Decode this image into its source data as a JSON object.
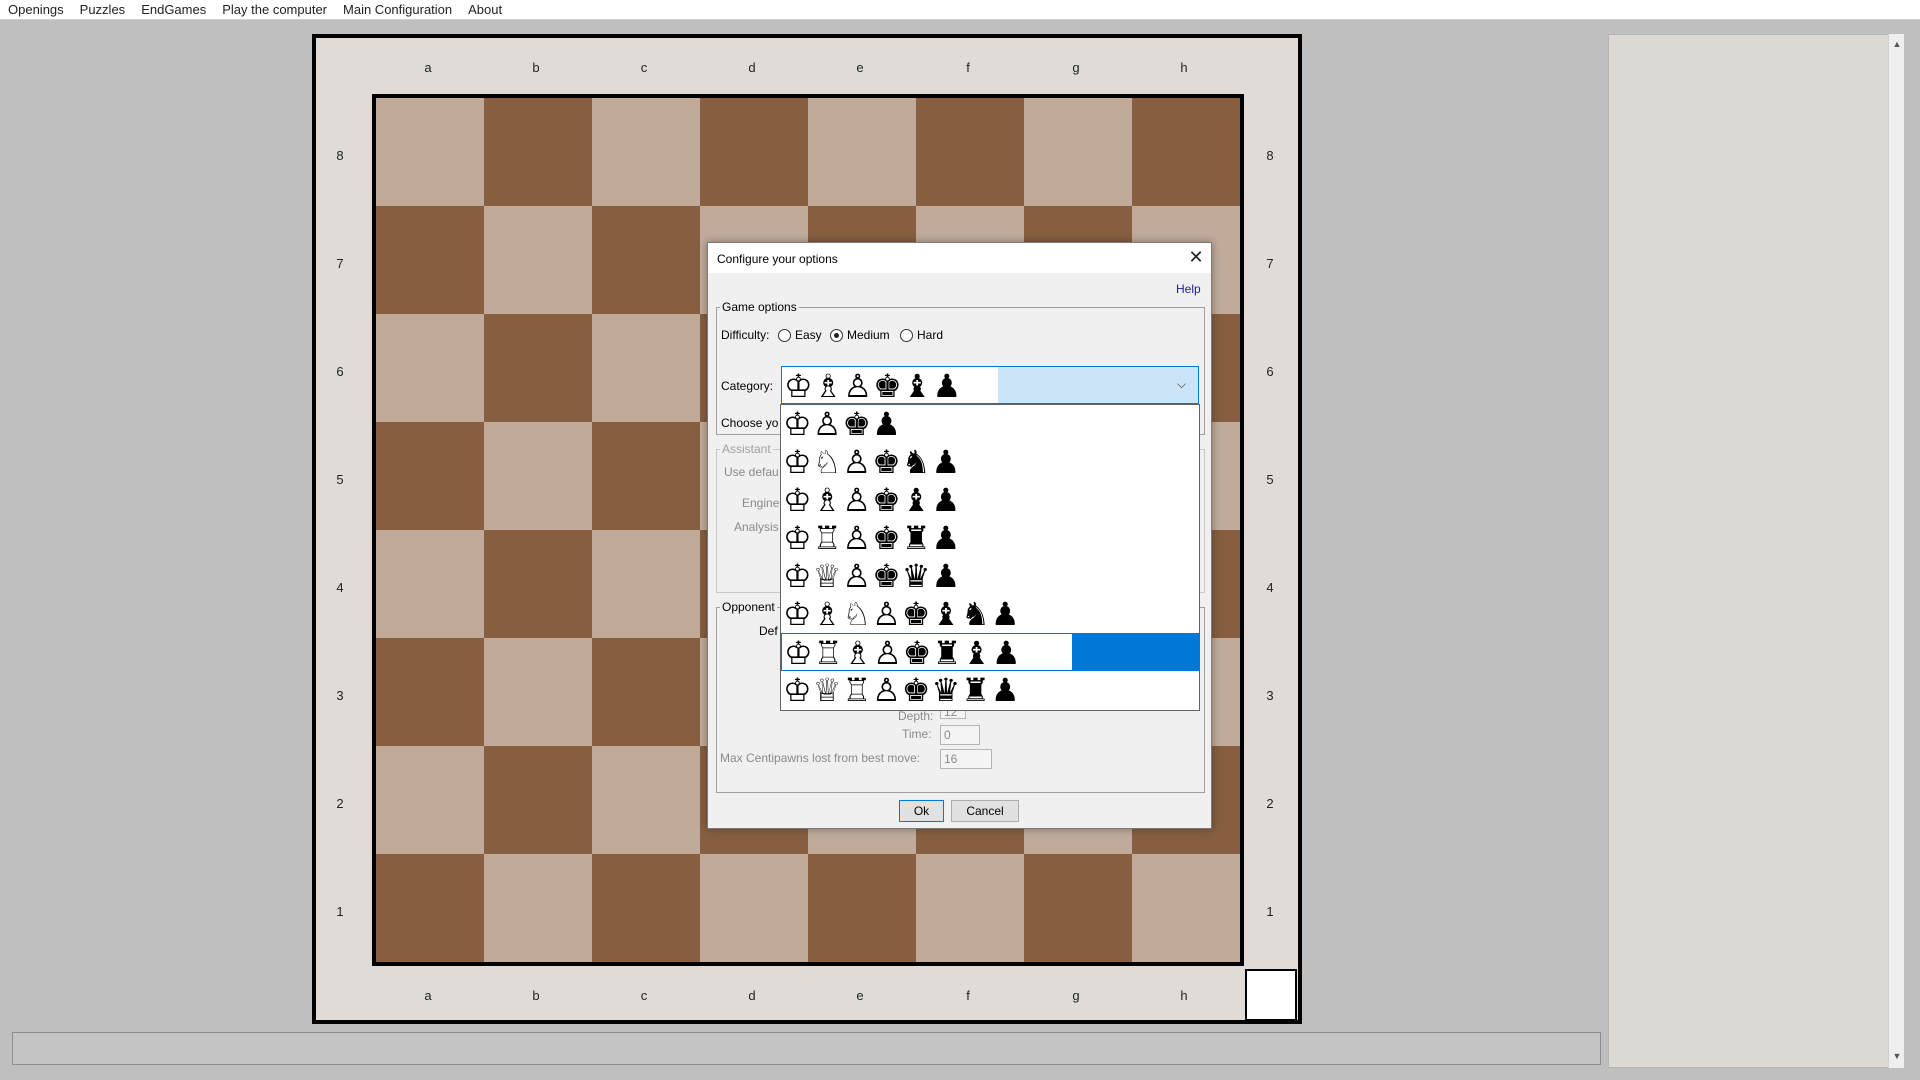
{
  "menu": [
    "Openings",
    "Puzzles",
    "EndGames",
    "Play the computer",
    "Main Configuration",
    "About"
  ],
  "board": {
    "files": [
      "a",
      "b",
      "c",
      "d",
      "e",
      "f",
      "g",
      "h"
    ],
    "ranks": [
      "8",
      "7",
      "6",
      "5",
      "4",
      "3",
      "2",
      "1"
    ],
    "light_color": "#c0ab9b",
    "dark_color": "#875e40"
  },
  "dialog": {
    "title": "Configure your options",
    "help": "Help",
    "game_options": {
      "legend": "Game options",
      "difficulty_label": "Difficulty:",
      "options": [
        {
          "label": "Easy",
          "selected": false
        },
        {
          "label": "Medium",
          "selected": true
        },
        {
          "label": "Hard",
          "selected": false
        }
      ],
      "category_label": "Category:",
      "category_selected": "♔♗♙♚♝♟",
      "choose_label": "Choose yo"
    },
    "assistant": {
      "legend": "Assistant",
      "use_default": "Use defau",
      "engine": "Engine",
      "analysis": "Analysis"
    },
    "opponent": {
      "legend": "Opponent",
      "default": "Def",
      "depth_label": "Depth:",
      "depth_value": "12",
      "time_label": "Time:",
      "time_value": "0",
      "max_cp_label": "Max Centipawns lost from best move:",
      "max_cp_value": "16"
    },
    "ok": "Ok",
    "cancel": "Cancel"
  },
  "dropdown": {
    "items": [
      "♔♙♚♟",
      "♔♘♙♚♞♟",
      "♔♗♙♚♝♟",
      "♔♖♙♚♜♟",
      "♔♕♙♚♛♟",
      "♔♗♘♙♚♝♞♟",
      "♔♖♗♙♚♜♝♟",
      "♔♕♖♙♚♛♜♟"
    ],
    "selected_index": 6
  },
  "colors": {
    "accent": "#0078d7",
    "link": "#1a1aa0"
  }
}
